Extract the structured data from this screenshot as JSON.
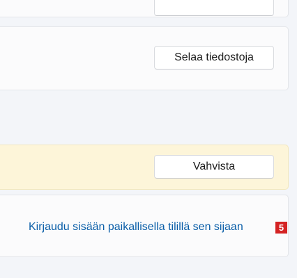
{
  "sections": {
    "files": {
      "button_label": "Selaa tiedostoja"
    },
    "warning": {
      "button_label": "Vahvista"
    },
    "local_account": {
      "link_label": "Kirjaudu sisään paikallisella tilillä sen sijaan",
      "badge": "5"
    }
  },
  "colors": {
    "background": "#f3f5f9",
    "card": "#fbfbfc",
    "warning_card": "#fdf5d9",
    "link": "#0a5ea8",
    "badge": "#d42323"
  }
}
